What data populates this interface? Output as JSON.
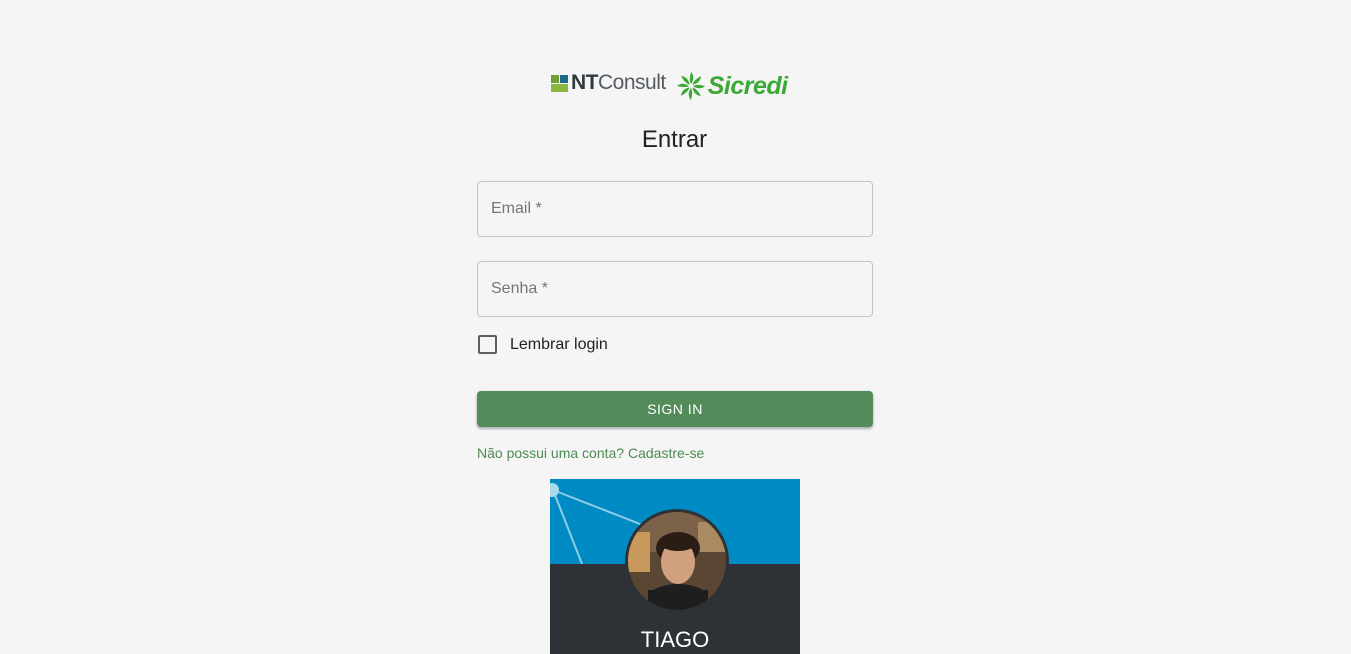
{
  "logos": {
    "ntconsult_bold": "NT",
    "ntconsult_light": "Consult",
    "sicredi": "Sicredi"
  },
  "login": {
    "title": "Entrar",
    "email_placeholder": "Email *",
    "password_placeholder": "Senha *",
    "remember_label": "Lembrar login",
    "signin_label": "SIGN IN",
    "register_link": "Não possui uma conta? Cadastre-se"
  },
  "profile_card": {
    "name": "TIAGO"
  },
  "colors": {
    "primary_green": "#548b5a",
    "link_green": "#4d8a55",
    "sicredi_green": "#3aa935",
    "card_blue": "#008bc4",
    "card_dark": "#2e3236"
  }
}
